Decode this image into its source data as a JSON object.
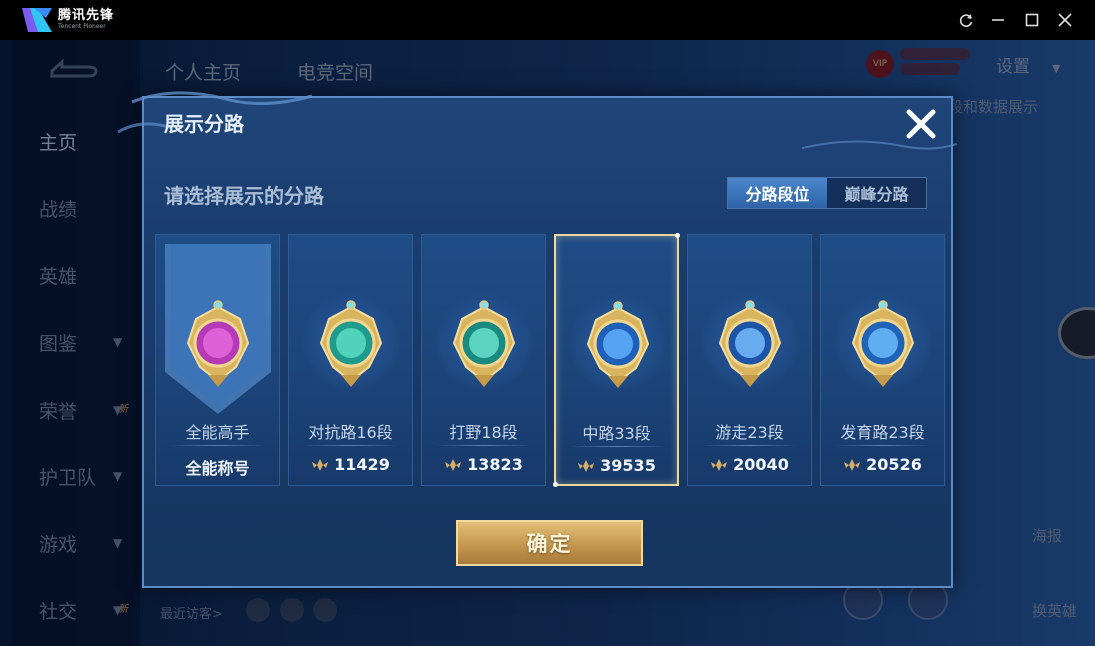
{
  "app": {
    "brand_cn": "腾讯先锋",
    "brand_en": "Tencent Pioneer"
  },
  "window_controls": [
    "refresh-icon",
    "minimize-icon",
    "maximize-icon",
    "close-icon"
  ],
  "background": {
    "top_tabs": [
      "个人主页",
      "电竞空间"
    ],
    "settings_label": "设置",
    "sidebar_items": [
      {
        "label": "主页",
        "active": true,
        "chevron": false,
        "new": false
      },
      {
        "label": "战绩",
        "active": false,
        "chevron": false,
        "new": false
      },
      {
        "label": "英雄",
        "active": false,
        "chevron": false,
        "new": false
      },
      {
        "label": "图鉴",
        "active": false,
        "chevron": true,
        "new": false
      },
      {
        "label": "荣誉",
        "active": false,
        "chevron": true,
        "new": true
      },
      {
        "label": "护卫队",
        "active": false,
        "chevron": true,
        "new": false
      },
      {
        "label": "游戏",
        "active": false,
        "chevron": true,
        "new": false
      },
      {
        "label": "社交",
        "active": false,
        "chevron": true,
        "new": true
      }
    ],
    "new_badge": "新",
    "right_text": "段和数据展示",
    "visitors_label": "最近访客>",
    "right_labels": [
      "海报",
      "换英雄"
    ]
  },
  "modal": {
    "title": "展示分路",
    "subtitle": "请选择展示的分路",
    "segments": [
      {
        "label": "分路段位",
        "active": true
      },
      {
        "label": "巅峰分路",
        "active": false
      }
    ],
    "cards": [
      {
        "label": "全能高手",
        "value": "全能称号",
        "show_power_icon": false,
        "selected": false,
        "banner": true,
        "emblem_color": "#b43ab8",
        "inner_color": "#e96be0"
      },
      {
        "label": "对抗路16段",
        "value": "11429",
        "show_power_icon": true,
        "selected": false,
        "banner": false,
        "emblem_color": "#1f9b8e",
        "inner_color": "#5fe0c6"
      },
      {
        "label": "打野18段",
        "value": "13823",
        "show_power_icon": true,
        "selected": false,
        "banner": false,
        "emblem_color": "#1b8a80",
        "inner_color": "#6ee6d2"
      },
      {
        "label": "中路33段",
        "value": "39535",
        "show_power_icon": true,
        "selected": true,
        "banner": false,
        "emblem_color": "#1e5fb8",
        "inner_color": "#64b4ff"
      },
      {
        "label": "游走23段",
        "value": "20040",
        "show_power_icon": true,
        "selected": false,
        "banner": false,
        "emblem_color": "#1c55a8",
        "inner_color": "#7cc1ff"
      },
      {
        "label": "发育路23段",
        "value": "20526",
        "show_power_icon": true,
        "selected": false,
        "banner": false,
        "emblem_color": "#1f64b8",
        "inner_color": "#6fc0ff"
      }
    ],
    "confirm_label": "确定"
  },
  "colors": {
    "accent_gold": "#d4ad66",
    "selected_border": "#e9d7a0",
    "segment_active": "#3f7bc2"
  }
}
